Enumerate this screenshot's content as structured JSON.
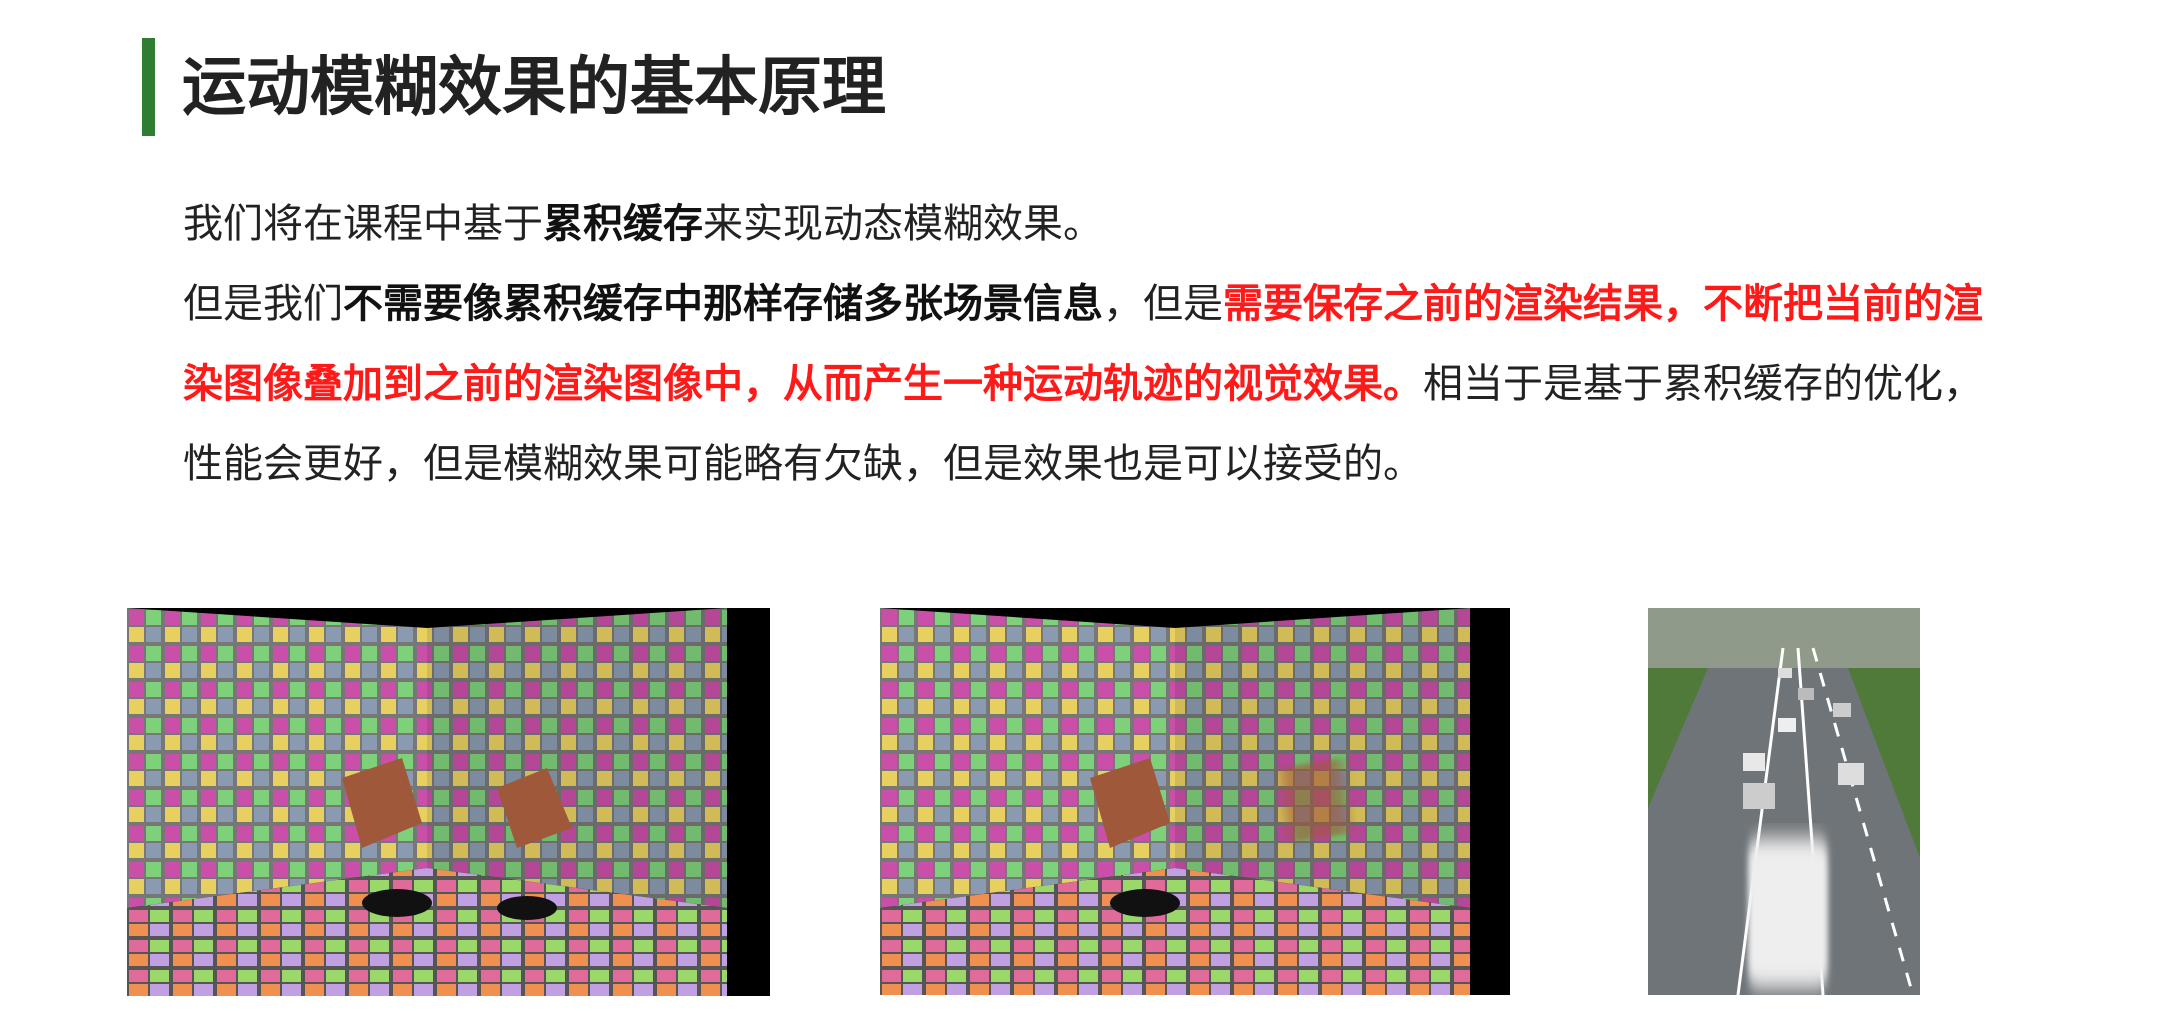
{
  "title": "运动模糊效果的基本原理",
  "paragraph": {
    "line1": {
      "a": "我们将在课程中基于",
      "b": "累积缓存",
      "c": "来实现动态模糊效果。"
    },
    "line2": {
      "a": "但是我们",
      "b": "不需要像累积缓存中那样存储多张场景信息",
      "c": "，但是",
      "d": "需要保存之前的渲染结果，不断把当前的渲"
    },
    "line3": {
      "a": "染图像叠加到之前的渲染图像中，从而产生一种运动轨迹的视觉效果。",
      "b": "相当于是基于累积缓存的优化，"
    },
    "line4": {
      "a": "性能会更好，但是模糊效果可能略有欠缺，但是效果也是可以接受的。"
    }
  },
  "colors": {
    "accent_bar": "#2e7d32",
    "highlight": "#ff1a1a",
    "text": "#222222"
  },
  "images": [
    {
      "name": "room-with-moving-cubes",
      "description_icon": "tiled-room-image"
    },
    {
      "name": "room-with-motion-blurred-cube",
      "description_icon": "tiled-room-blur-image"
    },
    {
      "name": "road-with-blurred-car",
      "description_icon": "road-photo-image"
    }
  ]
}
